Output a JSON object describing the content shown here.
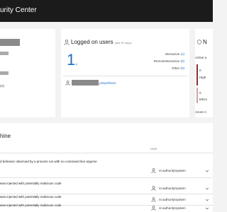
{
  "header": {
    "title": "urity Center"
  },
  "machine_card": {
    "os_fragment": "(S)"
  },
  "logged_on_users": {
    "title": "Logged on users",
    "subtitle": "(last 30 days)",
    "count": "1",
    "count_link": "b",
    "logon_types": [
      {
        "label": "Interactive",
        "count": "(1)"
      },
      {
        "label": "RemoteInteractive",
        "count": "(0)"
      },
      {
        "label": "Other",
        "count": "(0)"
      }
    ],
    "user_link": ".pimpolhee2"
  },
  "alerts_card": {
    "title": "N",
    "active_label": "Active a",
    "high": {
      "count": "0",
      "label": "High"
    },
    "medium": {
      "count": "0",
      "label": "Micro"
    },
    "footer": "Azure A"
  },
  "timeline": {
    "title": "hine",
    "user_col": "User",
    "events": [
      {
        "description": "d behavior observed by a process run with no command line argume",
        "user": "nt authority\\system"
      },
      {
        "description": "was injected with potentially malicious code",
        "user": "nt authority\\system"
      },
      {
        "description": "was injected with potentially malicious code",
        "user": "nt authority\\system"
      },
      {
        "description": "was injected with potentially malicious code",
        "user": "nt authority\\system"
      }
    ]
  },
  "colors": {
    "accent": "#1a6dc9",
    "high_severity": "#a4262c",
    "medium_severity": "#d9a0a0"
  }
}
